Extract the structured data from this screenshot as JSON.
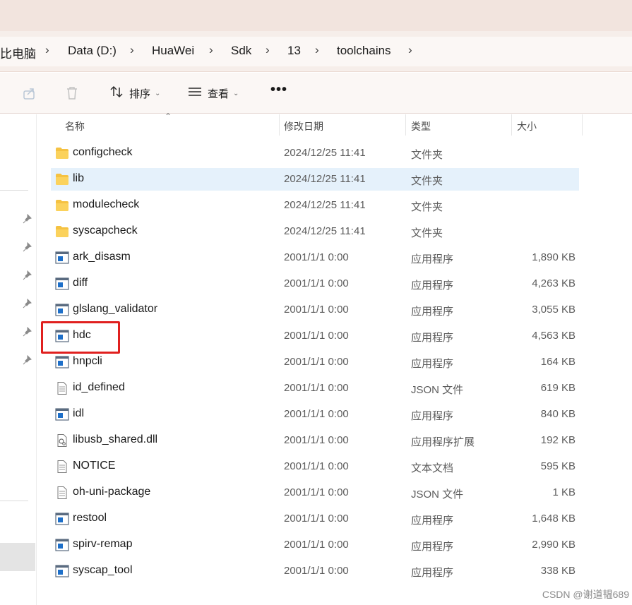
{
  "breadcrumb": [
    {
      "label": "比电脑"
    },
    {
      "label": "Data (D:)"
    },
    {
      "label": "HuaWei"
    },
    {
      "label": "Sdk"
    },
    {
      "label": "13"
    },
    {
      "label": "toolchains"
    }
  ],
  "breadcrumb_separator": "›",
  "toolbar": {
    "sort_label": "排序",
    "view_label": "查看",
    "more_label": "•••"
  },
  "columns": {
    "name": "名称",
    "date": "修改日期",
    "type": "类型",
    "size": "大小"
  },
  "files": [
    {
      "name": "configcheck",
      "date": "2024/12/25 11:41",
      "type": "文件夹",
      "size": "",
      "icon": "folder-icon"
    },
    {
      "name": "lib",
      "date": "2024/12/25 11:41",
      "type": "文件夹",
      "size": "",
      "icon": "folder-icon"
    },
    {
      "name": "modulecheck",
      "date": "2024/12/25 11:41",
      "type": "文件夹",
      "size": "",
      "icon": "folder-icon"
    },
    {
      "name": "syscapcheck",
      "date": "2024/12/25 11:41",
      "type": "文件夹",
      "size": "",
      "icon": "folder-icon"
    },
    {
      "name": "ark_disasm",
      "date": "2001/1/1 0:00",
      "type": "应用程序",
      "size": "1,890 KB",
      "icon": "application-icon"
    },
    {
      "name": "diff",
      "date": "2001/1/1 0:00",
      "type": "应用程序",
      "size": "4,263 KB",
      "icon": "application-icon"
    },
    {
      "name": "glslang_validator",
      "date": "2001/1/1 0:00",
      "type": "应用程序",
      "size": "3,055 KB",
      "icon": "application-icon"
    },
    {
      "name": "hdc",
      "date": "2001/1/1 0:00",
      "type": "应用程序",
      "size": "4,563 KB",
      "icon": "application-icon"
    },
    {
      "name": "hnpcli",
      "date": "2001/1/1 0:00",
      "type": "应用程序",
      "size": "164 KB",
      "icon": "application-icon"
    },
    {
      "name": "id_defined",
      "date": "2001/1/1 0:00",
      "type": "JSON 文件",
      "size": "619 KB",
      "icon": "document-icon"
    },
    {
      "name": "idl",
      "date": "2001/1/1 0:00",
      "type": "应用程序",
      "size": "840 KB",
      "icon": "application-icon"
    },
    {
      "name": "libusb_shared.dll",
      "date": "2001/1/1 0:00",
      "type": "应用程序扩展",
      "size": "192 KB",
      "icon": "dll-icon"
    },
    {
      "name": "NOTICE",
      "date": "2001/1/1 0:00",
      "type": "文本文档",
      "size": "595 KB",
      "icon": "document-icon"
    },
    {
      "name": "oh-uni-package",
      "date": "2001/1/1 0:00",
      "type": "JSON 文件",
      "size": "1 KB",
      "icon": "document-icon"
    },
    {
      "name": "restool",
      "date": "2001/1/1 0:00",
      "type": "应用程序",
      "size": "1,648 KB",
      "icon": "application-icon"
    },
    {
      "name": "spirv-remap",
      "date": "2001/1/1 0:00",
      "type": "应用程序",
      "size": "2,990 KB",
      "icon": "application-icon"
    },
    {
      "name": "syscap_tool",
      "date": "2001/1/1 0:00",
      "type": "应用程序",
      "size": "338 KB",
      "icon": "application-icon"
    }
  ],
  "selected_file": "lib",
  "highlighted_file": "hdc",
  "watermark": "CSDN @谢道韫689",
  "colors": {
    "selection": "#e5f1fb",
    "highlight_border": "#e0201f",
    "folder": "#f5c242",
    "app_icon": "#1d6fc9"
  }
}
